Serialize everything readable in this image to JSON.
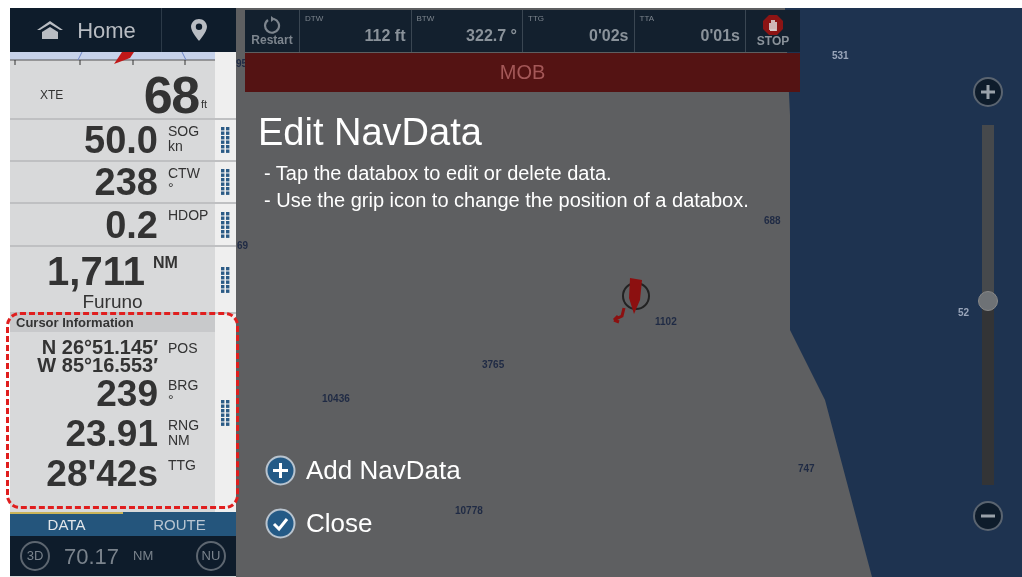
{
  "header": {
    "home": "Home"
  },
  "nav_bar": {
    "restart": "Restart",
    "fields": [
      {
        "label": "DTW",
        "value": "112 ft"
      },
      {
        "label": "BTW",
        "value": "322.7 °"
      },
      {
        "label": "TTG",
        "value": "0'02s"
      },
      {
        "label": "TTA",
        "value": "0'01s"
      }
    ],
    "stop": "STOP"
  },
  "mob_banner": "MOB",
  "databoxes": [
    {
      "kind": "hero",
      "label": "XTE",
      "value": "68",
      "unit": "ft",
      "grip": false
    },
    {
      "kind": "stat",
      "value": "50.0",
      "label": "SOG",
      "unit": "kn",
      "grip": true
    },
    {
      "kind": "stat",
      "value": "238",
      "label": "CTW",
      "unit": "°",
      "grip": true
    },
    {
      "kind": "stat",
      "value": "0.2",
      "label": "HDOP",
      "grip": true
    },
    {
      "kind": "captioned",
      "value": "1,711",
      "unit": "NM",
      "caption": "Furuno",
      "grip": true
    }
  ],
  "cursor_info": {
    "title": "Cursor Information",
    "rows": [
      {
        "kind": "position",
        "lines": [
          "N 26°51.145′",
          "W 85°16.553′"
        ],
        "label": "POS"
      },
      {
        "kind": "stat",
        "value": "239",
        "label": "BRG",
        "unit": "°"
      },
      {
        "kind": "stat",
        "value": "23.91",
        "label": "RNG",
        "unit": "NM"
      },
      {
        "kind": "stat",
        "value": "28'42s",
        "label": "TTG"
      }
    ]
  },
  "tabs": [
    {
      "label": "DATA",
      "selected": true
    },
    {
      "label": "ROUTE",
      "selected": false
    }
  ],
  "footer": {
    "left": "3D",
    "value": "70.17",
    "unit": "NM",
    "right": "NU"
  },
  "dialog": {
    "title": "Edit NavData",
    "instructions": [
      "- Tap the databox to edit or delete data.",
      "- Use the grip icon to change the position of a databox."
    ],
    "actions": [
      {
        "kind": "add",
        "label": "Add NavData"
      },
      {
        "kind": "close",
        "label": "Close"
      }
    ]
  },
  "map": {
    "soundings": [
      "95",
      "69",
      "531",
      "688",
      "52",
      "1102",
      "3765",
      "10436",
      "10778",
      "747"
    ]
  },
  "zoom": {
    "level": 0.51
  }
}
